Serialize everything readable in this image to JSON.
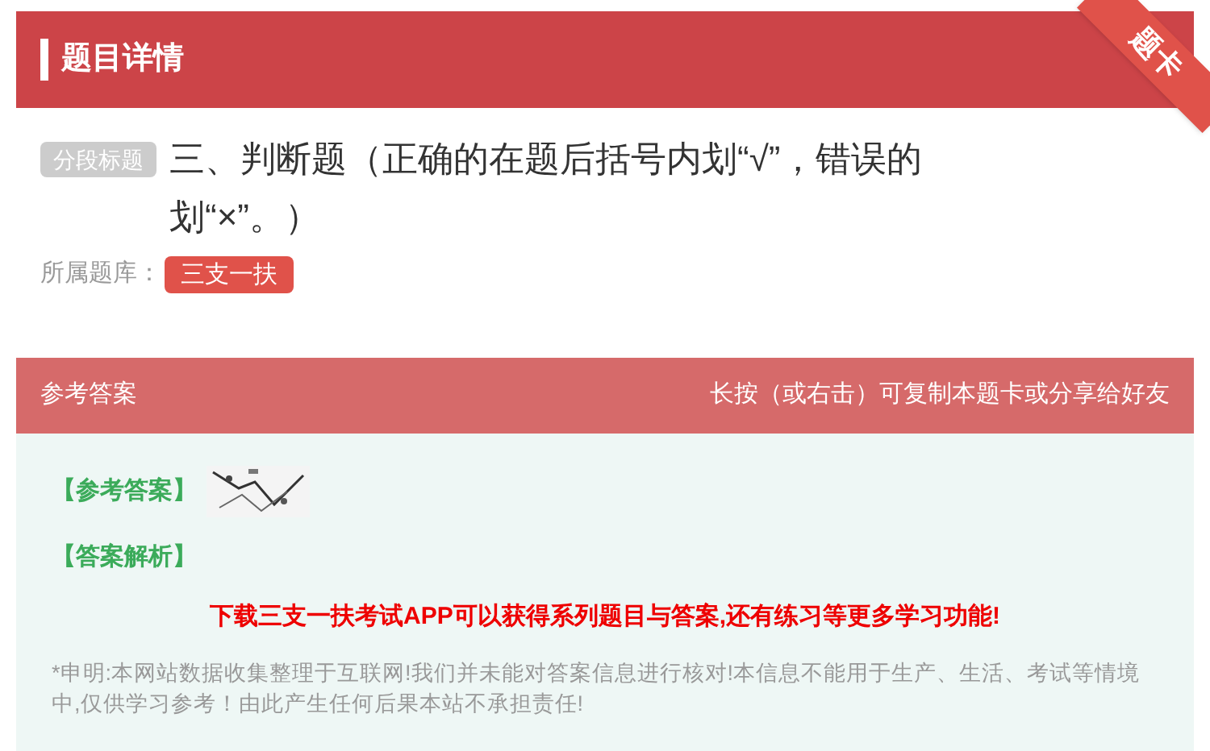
{
  "header": {
    "title": "题目详情",
    "ribbon": "题卡"
  },
  "question": {
    "tag": "分段标题",
    "text": "三、判断题（正确的在题后括号内划“√”，错误的划“×”。）"
  },
  "bank": {
    "label": "所属题库：",
    "name": "三支一扶"
  },
  "answer_bar": {
    "title": "参考答案",
    "hint": "长按（或右击）可复制本题卡或分享给好友"
  },
  "answer": {
    "label": "【参考答案】"
  },
  "analysis": {
    "label": "【答案解析】"
  },
  "promo": "下载三支一扶考试APP可以获得系列题目与答案,还有练习等更多学习功能!",
  "disclaimer": "*申明:本网站数据收集整理于互联网!我们并未能对答案信息进行核对!本信息不能用于生产、生活、考试等情境中,仅供学习参考！由此产生任何后果本站不承担责任!"
}
